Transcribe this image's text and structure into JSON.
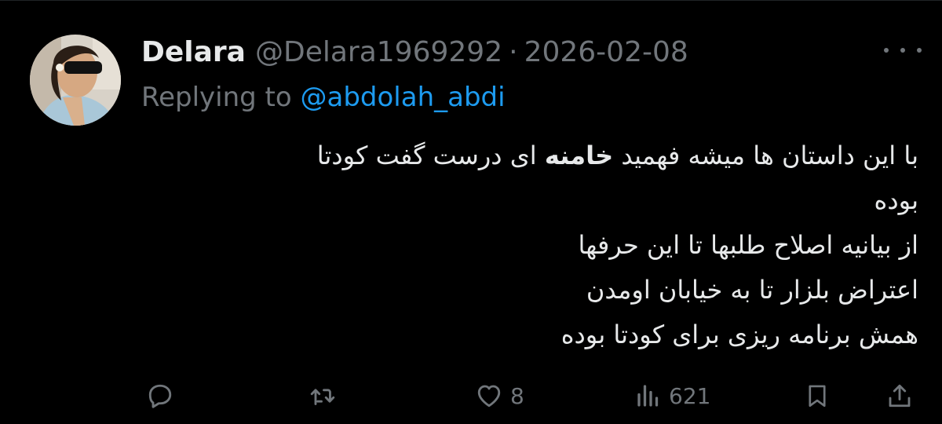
{
  "tweet": {
    "author_name": "Delara",
    "author_handle": "@Delara1969292",
    "separator": "·",
    "date": "2026-02-08",
    "replying_prefix": "Replying to",
    "replying_to": "@abdolah_abdi",
    "line1_before": "با این داستان ها میشه فهمید ",
    "line1_bold": "خامنه",
    "line1_after": " ای درست گفت کودتا",
    "line2": "بوده",
    "line3": "از  بیانیه اصلاح طلبها تا این حرفها",
    "line4": "اعتراض بلزار تا به خیابان اومدن",
    "line5": "همش برنامه ریزی برای کودتا بوده"
  },
  "actions": {
    "like_count": "8",
    "views_count": "621"
  },
  "icons": [
    "reply-icon",
    "retweet-icon",
    "like-icon",
    "views-icon",
    "bookmark-icon",
    "share-icon",
    "more-icon"
  ],
  "colors": {
    "background": "#000000",
    "text": "#e7e9ea",
    "muted": "#71767b",
    "link": "#1d9bf0"
  }
}
